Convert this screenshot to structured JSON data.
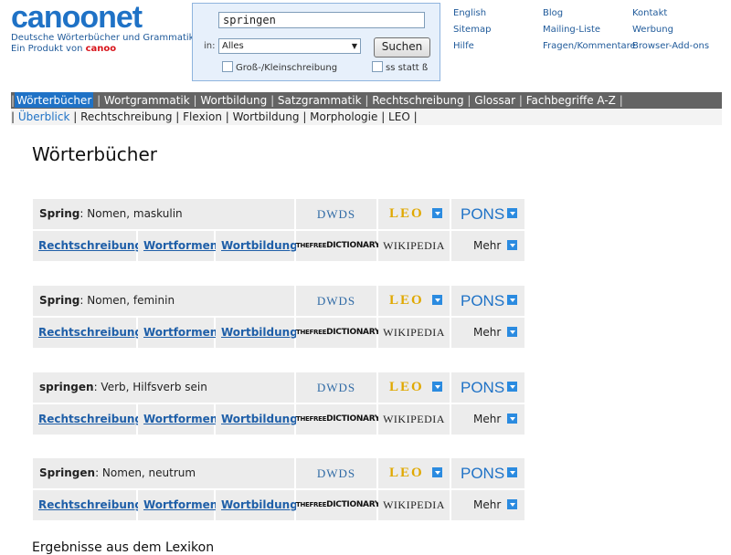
{
  "logo": {
    "text": "canoonet",
    "tagline_line1": "Deutsche Wörterbücher und Grammatik",
    "tagline_prefix": "Ein Produkt von",
    "tagline_brand": "canoo"
  },
  "search": {
    "value": "springen",
    "in_label": "in:",
    "scope_selected": "Alles",
    "button_label": "Suchen",
    "option_case": "Groß-/Kleinschreibung",
    "option_ss": "ss statt ß"
  },
  "toplinks": {
    "col1": [
      "English",
      "Sitemap",
      "Hilfe"
    ],
    "col2": [
      "Blog",
      "Mailing-Liste",
      "Fragen/Kommentare"
    ],
    "col3": [
      "Kontakt",
      "Werbung",
      "Browser-Add-ons"
    ]
  },
  "nav": {
    "main": [
      "Wörterbücher",
      "Wortgrammatik",
      "Wortbildung",
      "Satzgrammatik",
      "Rechtschreibung",
      "Glossar",
      "Fachbegriffe A-Z"
    ],
    "sub": [
      "Überblick",
      "Rechtschreibung",
      "Flexion",
      "Wortbildung",
      "Morphologie",
      "LEO"
    ]
  },
  "page_title": "Wörterbücher",
  "resources": {
    "dwds": "DWDS",
    "leo": "LEO",
    "pons": "PONS",
    "tfd_the": "THE",
    "tfd_free": "FREE",
    "tfd_dict": "DICTIONARY",
    "wikipedia": "WIKIPEDIA",
    "mehr": "Mehr",
    "links": [
      "Rechtschreibung",
      "Wortformen",
      "Wortbildung"
    ]
  },
  "entries": [
    {
      "word": "Spring",
      "desc": ": Nomen, maskulin"
    },
    {
      "word": "Spring",
      "desc": ": Nomen, feminin"
    },
    {
      "word": "springen",
      "desc": ": Verb, Hilfsverb sein"
    },
    {
      "word": "Springen",
      "desc": ": Nomen, neutrum"
    }
  ],
  "bottom_cut_text": "Ergebnisse aus dem Lexikon"
}
